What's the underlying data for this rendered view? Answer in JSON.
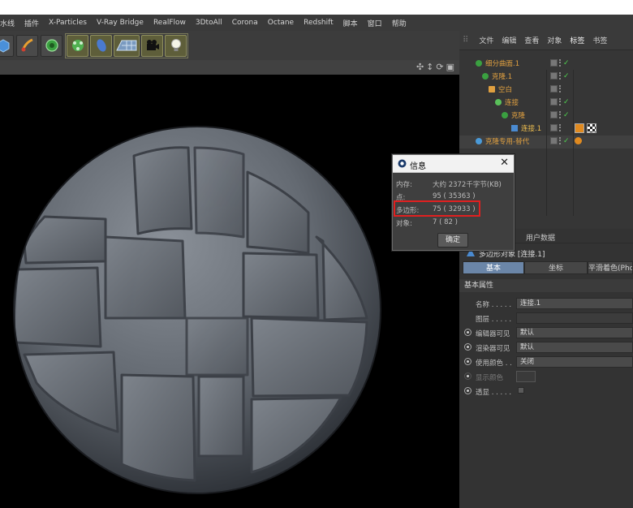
{
  "menubar": {
    "items": [
      "水线",
      "插件",
      "X-Particles",
      "V-Ray Bridge",
      "RealFlow",
      "3DtoAll",
      "Corona",
      "Octane",
      "Redshift",
      "脚本",
      "窗口",
      "帮助"
    ]
  },
  "toolbar": {
    "icons": [
      "cube-icon",
      "brush-icon",
      "cloner-icon",
      "deformer-icon",
      "sweep-icon",
      "floor-icon",
      "camera-icon",
      "light-icon"
    ]
  },
  "viewport": {
    "nav_icons": [
      "move-view-icon",
      "zoom-view-icon",
      "rotate-view-icon",
      "toggle-view-icon"
    ],
    "background": "#000000",
    "sphere_color": "#6a7078"
  },
  "object_manager": {
    "menu": [
      "文件",
      "编辑",
      "查看",
      "对象",
      "标签",
      "书签"
    ],
    "active_menu": "标签",
    "rows": [
      {
        "name": "细分曲面.1",
        "indent": 0,
        "color": "#e0a040",
        "check": true
      },
      {
        "name": "克隆.1",
        "indent": 1,
        "color": "#e0a040",
        "check": true
      },
      {
        "name": "空白",
        "indent": 2,
        "color": "#e0a040",
        "check": false
      },
      {
        "name": "连接",
        "indent": 3,
        "color": "#e0a040",
        "check": true
      },
      {
        "name": "克隆",
        "indent": 4,
        "color": "#e0a040",
        "check": true
      },
      {
        "name": "连接.1",
        "indent": 5,
        "color": "#f0c050",
        "check": false
      },
      {
        "name": "克隆专用-替代",
        "indent": 0,
        "color": "#e0a040",
        "check": true
      }
    ]
  },
  "attributes": {
    "top_tabs": [
      "用户数据"
    ],
    "object_title": "多边形对象 [连接.1]",
    "mode_tabs": [
      "基本",
      "坐标",
      "平滑着色(Pho"
    ],
    "active_mode": "基本",
    "section": "基本属性",
    "props": [
      {
        "label": "名称 . . . . .",
        "value": "连接.1"
      },
      {
        "label": "图层 . . . . .",
        "value": ""
      },
      {
        "label": "编辑器可见",
        "value": "默认"
      },
      {
        "label": "渲染器可见",
        "value": "默认"
      },
      {
        "label": "使用颜色 . .",
        "value": "关闭"
      },
      {
        "label": "显示颜色",
        "value": ""
      },
      {
        "label": "透显 . . . . .",
        "value": ""
      }
    ]
  },
  "info_dialog": {
    "title": "信息",
    "rows": [
      {
        "key": "内存:",
        "value": "大约 2372千字节(KB)"
      },
      {
        "key": "点:",
        "value": "95 ( 35363 )"
      },
      {
        "key": "多边形:",
        "value": "75 ( 32933 )"
      },
      {
        "key": "对象:",
        "value": "7 ( 82 )"
      }
    ],
    "ok_label": "确定",
    "highlight_color": "#e02020"
  }
}
